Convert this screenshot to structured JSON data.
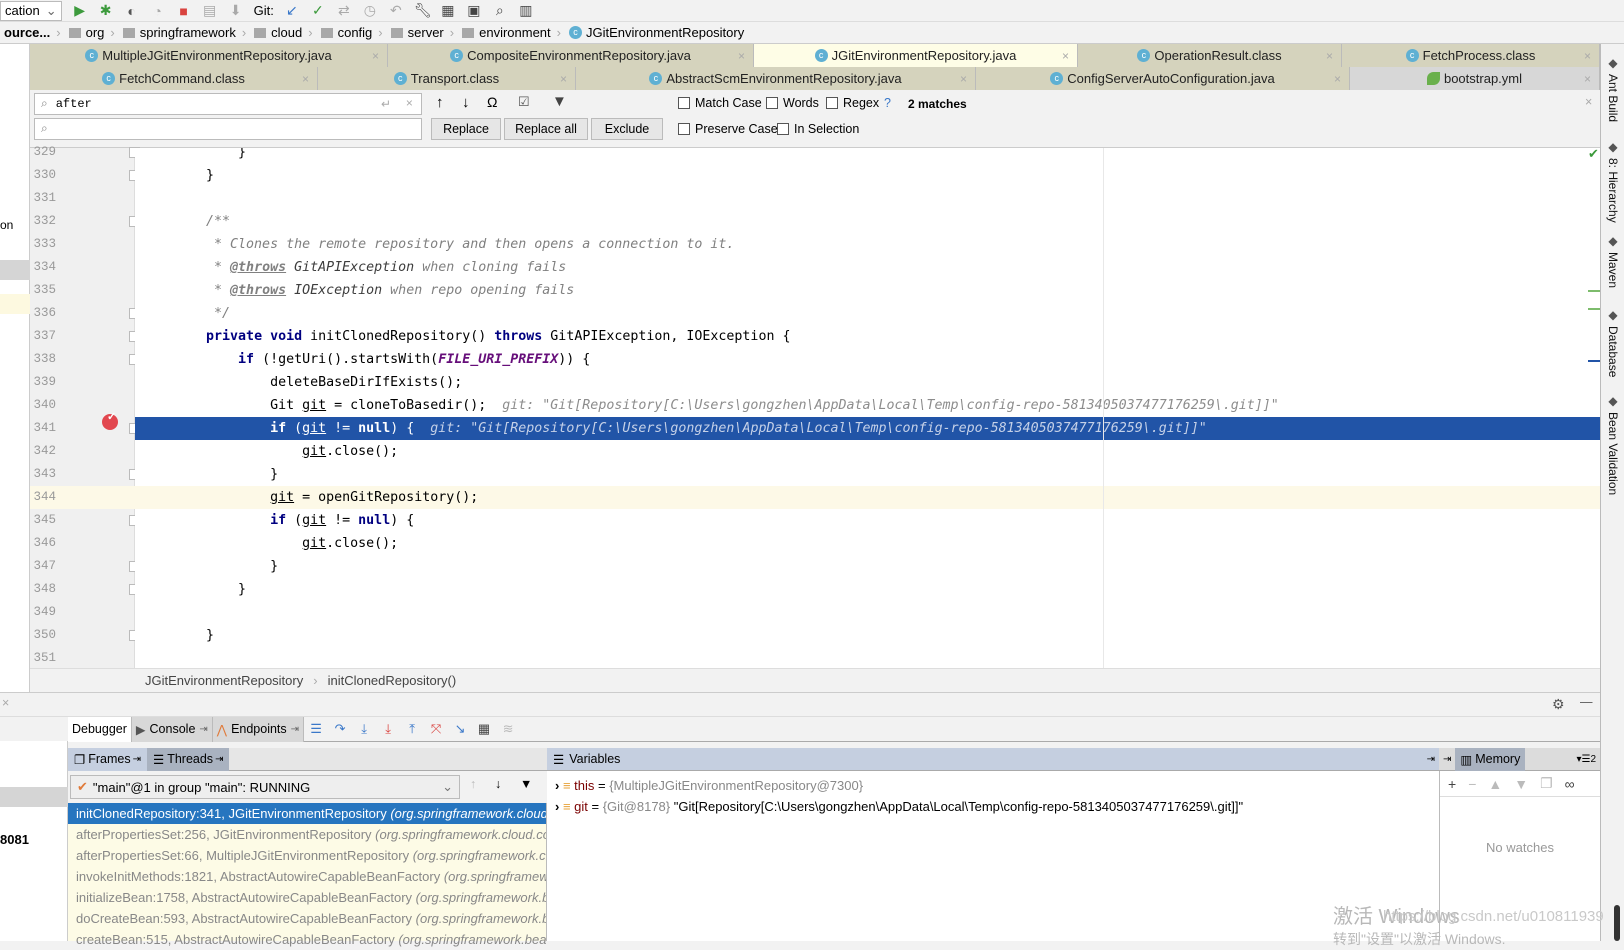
{
  "toolbar": {
    "run_config": "cation",
    "git_label": "Git:"
  },
  "nav": {
    "items": [
      "ource...",
      "org",
      "springframework",
      "cloud",
      "config",
      "server",
      "environment",
      "JGitEnvironmentRepository"
    ]
  },
  "tabs": {
    "row1": [
      {
        "label": "MultipleJGitEnvironmentRepository.java",
        "w": 358
      },
      {
        "label": "CompositeEnvironmentRepository.java",
        "w": 366
      },
      {
        "label": "JGitEnvironmentRepository.java",
        "w": 324,
        "active": true
      },
      {
        "label": "OperationResult.class",
        "w": 264
      },
      {
        "label": "FetchProcess.class",
        "w": 258
      }
    ],
    "row2": [
      {
        "label": "FetchCommand.class",
        "w": 288
      },
      {
        "label": "Transport.class",
        "w": 258
      },
      {
        "label": "AbstractScmEnvironmentRepository.java",
        "w": 400
      },
      {
        "label": "ConfigServerAutoConfiguration.java",
        "w": 374
      },
      {
        "label": "bootstrap.yml",
        "w": 250,
        "gray": true
      }
    ]
  },
  "find": {
    "search_value": "after",
    "replace_value": "",
    "replace": "Replace",
    "replace_all": "Replace all",
    "exclude": "Exclude",
    "match_case": "Match Case",
    "words": "Words",
    "regex": "Regex",
    "help": "?",
    "matches": "2 matches",
    "preserve_case": "Preserve Case",
    "in_selection": "In Selection"
  },
  "code": {
    "lines": [
      {
        "n": "329",
        "segs": [
          {
            "t": "        }"
          }
        ]
      },
      {
        "n": "330",
        "segs": [
          {
            "t": "    }"
          }
        ]
      },
      {
        "n": "331",
        "segs": []
      },
      {
        "n": "332",
        "segs": [
          {
            "t": "    /**",
            "c": "cm"
          }
        ]
      },
      {
        "n": "333",
        "segs": [
          {
            "t": "     * Clones the remote repository and then opens a connection to it.",
            "c": "cm"
          }
        ]
      },
      {
        "n": "334",
        "segs": [
          {
            "t": "     * ",
            "c": "cm"
          },
          {
            "t": "@throws",
            "c": "tag"
          },
          {
            "t": " GitAPIException",
            "c": "cmr"
          },
          {
            "t": " when cloning fails",
            "c": "cm"
          }
        ]
      },
      {
        "n": "335",
        "segs": [
          {
            "t": "     * ",
            "c": "cm"
          },
          {
            "t": "@throws",
            "c": "tag"
          },
          {
            "t": " IOException",
            "c": "cmr"
          },
          {
            "t": " when repo opening fails",
            "c": "cm"
          }
        ]
      },
      {
        "n": "336",
        "segs": [
          {
            "t": "     */",
            "c": "cm"
          }
        ]
      },
      {
        "n": "337",
        "segs": [
          {
            "t": "    "
          },
          {
            "t": "private void",
            "c": "kw"
          },
          {
            "t": " initClonedRepository() "
          },
          {
            "t": "throws",
            "c": "kw"
          },
          {
            "t": " GitAPIException, IOException {"
          }
        ]
      },
      {
        "n": "338",
        "segs": [
          {
            "t": "        "
          },
          {
            "t": "if",
            "c": "kw"
          },
          {
            "t": " (!getUri().startsWith("
          },
          {
            "t": "FILE_URI_PREFIX",
            "c": "const"
          },
          {
            "t": ")) {"
          }
        ]
      },
      {
        "n": "339",
        "segs": [
          {
            "t": "            deleteBaseDirIfExists();"
          }
        ]
      },
      {
        "n": "340",
        "segs": [
          {
            "t": "            Git "
          },
          {
            "t": "git",
            "c": "ul"
          },
          {
            "t": " = cloneToBasedir();  "
          },
          {
            "t": "git: \"Git[Repository[C:\\Users\\gongzhen\\AppData\\Local\\Temp\\config-repo-5813405037477176259\\.git]]\"",
            "c": "hint"
          }
        ]
      },
      {
        "n": "341",
        "segs": [
          {
            "t": "            "
          },
          {
            "t": "if",
            "c": "kw"
          },
          {
            "t": " ("
          },
          {
            "t": "git",
            "c": "ul"
          },
          {
            "t": " != "
          },
          {
            "t": "null",
            "c": "kw"
          },
          {
            "t": ") {  "
          },
          {
            "t": "git: \"Git[Repository[C:\\Users\\gongzhen\\AppData\\Local\\Temp\\config-repo-5813405037477176259\\.git]]\"",
            "c": "hint"
          }
        ],
        "state": "sel"
      },
      {
        "n": "342",
        "segs": [
          {
            "t": "                "
          },
          {
            "t": "git",
            "c": "ul"
          },
          {
            "t": ".close();"
          }
        ]
      },
      {
        "n": "343",
        "segs": [
          {
            "t": "            }"
          }
        ]
      },
      {
        "n": "344",
        "segs": [
          {
            "t": "            "
          },
          {
            "t": "git",
            "c": "ul"
          },
          {
            "t": " = openGitRepository();"
          }
        ],
        "state": "cur"
      },
      {
        "n": "345",
        "segs": [
          {
            "t": "            "
          },
          {
            "t": "if",
            "c": "kw"
          },
          {
            "t": " ("
          },
          {
            "t": "git",
            "c": "ul"
          },
          {
            "t": " != "
          },
          {
            "t": "null",
            "c": "kw"
          },
          {
            "t": ") {"
          }
        ]
      },
      {
        "n": "346",
        "segs": [
          {
            "t": "                "
          },
          {
            "t": "git",
            "c": "ul"
          },
          {
            "t": ".close();"
          }
        ]
      },
      {
        "n": "347",
        "segs": [
          {
            "t": "            }"
          }
        ]
      },
      {
        "n": "348",
        "segs": [
          {
            "t": "        }"
          }
        ]
      },
      {
        "n": "349",
        "segs": []
      },
      {
        "n": "350",
        "segs": [
          {
            "t": "    }"
          }
        ]
      },
      {
        "n": "351",
        "segs": []
      }
    ]
  },
  "editor_breadcrumb": {
    "class": "JGitEnvironmentRepository",
    "method": "initClonedRepository()"
  },
  "right_tools": [
    "Ant Build",
    "8: Hierarchy",
    "Maven",
    "Database",
    "Bean Validation"
  ],
  "debug": {
    "tabs": {
      "debugger": "Debugger",
      "console": "Console",
      "endpoints": "Endpoints"
    },
    "frames_tab": "Frames",
    "threads_tab": "Threads",
    "variables_title": "Variables",
    "memory_tab": "Memory",
    "thread": "\"main\"@1 in group \"main\": RUNNING",
    "frames": [
      {
        "m": "initClonedRepository:341, JGitEnvironmentRepository ",
        "p": "(org.springframework.cloud.config.server.environment)"
      },
      {
        "m": "afterPropertiesSet:256, JGitEnvironmentRepository ",
        "p": "(org.springframework.cloud.config.server.environment)"
      },
      {
        "m": "afterPropertiesSet:66, MultipleJGitEnvironmentRepository ",
        "p": "(org.springframework.cloud.config.server.environment)"
      },
      {
        "m": "invokeInitMethods:1821, AbstractAutowireCapableBeanFactory ",
        "p": "(org.springframework.beans.factory.support)"
      },
      {
        "m": "initializeBean:1758, AbstractAutowireCapableBeanFactory ",
        "p": "(org.springframework.beans.factory.support)"
      },
      {
        "m": "doCreateBean:593, AbstractAutowireCapableBeanFactory ",
        "p": "(org.springframework.beans.factory.support)"
      },
      {
        "m": "createBean:515, AbstractAutowireCapableBeanFactory ",
        "p": "(org.springframework.beans.factory.support)"
      }
    ],
    "variables": [
      {
        "name": "this",
        "eq": " = ",
        "ref": "{MultipleJGitEnvironmentRepository@7300}",
        "val": ""
      },
      {
        "name": "git",
        "eq": " = ",
        "ref": "{Git@8178} ",
        "val": "\"Git[Repository[C:\\Users\\gongzhen\\AppData\\Local\\Temp\\config-repo-5813405037477176259\\.git]]\""
      }
    ],
    "no_watches": "No watches"
  },
  "left_fragments": {
    "on": "on",
    "port": "8081"
  },
  "watermark": {
    "line1": "激活 Windows",
    "line2": "转到\"设置\"以激活 Windows.",
    "url": "https://blog.csdn.net/u010811939"
  }
}
